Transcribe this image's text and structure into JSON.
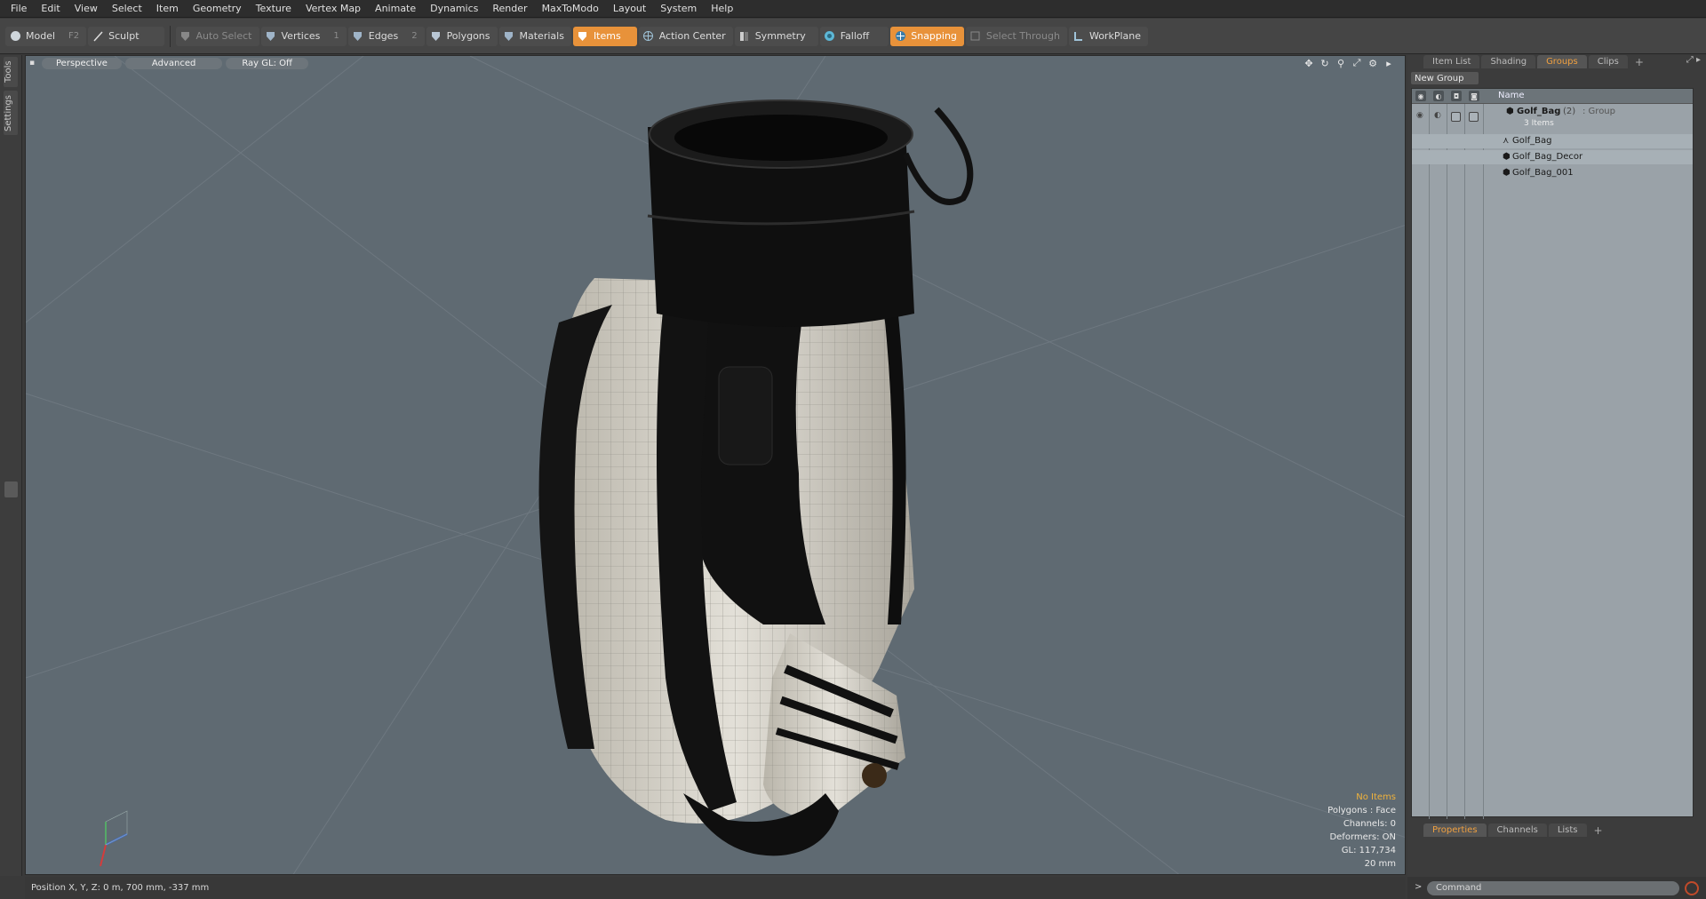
{
  "menu": [
    "File",
    "Edit",
    "View",
    "Select",
    "Item",
    "Geometry",
    "Texture",
    "Vertex Map",
    "Animate",
    "Dynamics",
    "Render",
    "MaxToModo",
    "Layout",
    "System",
    "Help"
  ],
  "toolbar": {
    "model": "Model",
    "model_key": "F2",
    "sculpt": "Sculpt",
    "auto_select": "Auto Select",
    "vertices": "Vertices",
    "vertices_key": "1",
    "edges": "Edges",
    "edges_key": "2",
    "polygons": "Polygons",
    "materials": "Materials",
    "items": "Items",
    "action_center": "Action Center",
    "symmetry": "Symmetry",
    "falloff": "Falloff",
    "snapping": "Snapping",
    "select_through": "Select Through",
    "workplane": "WorkPlane",
    "accent_color": "#e8923a"
  },
  "left_strip": {
    "tools": "Tools",
    "settings": "Settings"
  },
  "viewport": {
    "view": "Perspective",
    "shading": "Advanced",
    "raygl": "Ray GL: Off",
    "info": {
      "selection": "No Items",
      "polygons": "Polygons : Face",
      "channels": "Channels: 0",
      "deformers": "Deformers: ON",
      "gl": "GL: 117,734",
      "grid": "20 mm"
    },
    "background_color": "#5f6a72"
  },
  "status": {
    "position": "Position X, Y, Z:  0 m, 700 mm, -337 mm"
  },
  "right_panel": {
    "tabs": [
      "Item List",
      "Shading",
      "Groups",
      "Clips"
    ],
    "active_tab": "Groups",
    "new_group": "New Group",
    "column_name": "Name",
    "group": {
      "name": "Golf_Bag",
      "count": "(2)",
      "type": ": Group",
      "items_label": "3 Items"
    },
    "items": [
      "Golf_Bag",
      "Golf_Bag_Decor",
      "Golf_Bag_001"
    ],
    "bottom_tabs": [
      "Properties",
      "Channels",
      "Lists"
    ],
    "bottom_active": "Properties",
    "command_placeholder": "Command"
  }
}
